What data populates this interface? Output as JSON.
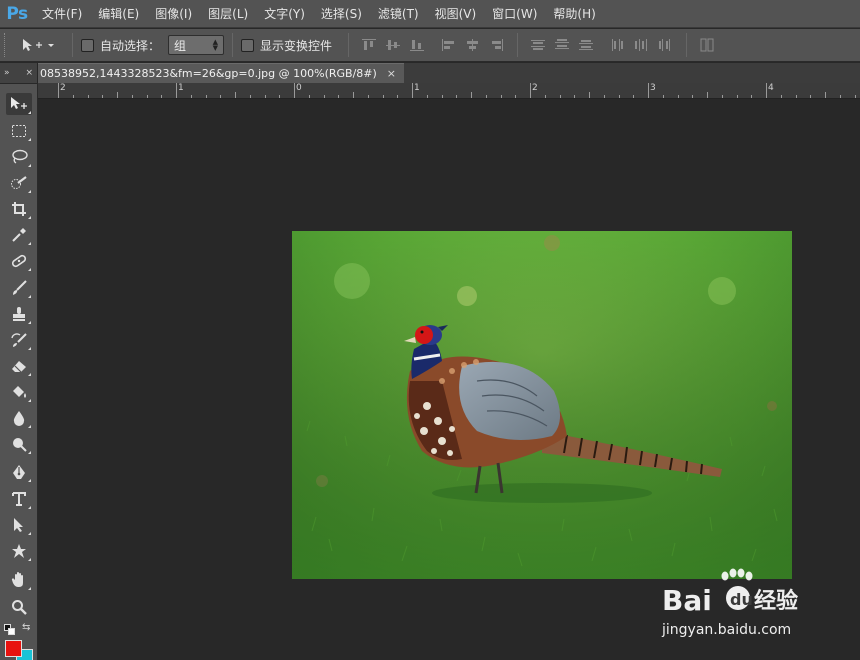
{
  "app": {
    "logo": "Ps"
  },
  "menu": {
    "items": [
      "文件(F)",
      "编辑(E)",
      "图像(I)",
      "图层(L)",
      "文字(Y)",
      "选择(S)",
      "滤镜(T)",
      "视图(V)",
      "窗口(W)",
      "帮助(H)"
    ]
  },
  "options": {
    "auto_select_label": "自动选择：",
    "auto_select_value": "组",
    "show_transform_label": "显示变换控件"
  },
  "document": {
    "tab_title": "08538952,1443328523&fm=26&gp=0.jpg @ 100%(RGB/8#)",
    "close_symbol": "×"
  },
  "panel_collapse": {
    "expand": "»",
    "close": "×"
  },
  "ruler": {
    "labels": [
      "2",
      "1",
      "0",
      "1",
      "2",
      "3",
      "4"
    ]
  },
  "colors": {
    "foreground": "#e8130f",
    "background": "#19c3d6",
    "accent": "#4aa8e8"
  },
  "watermark": {
    "brand_left": "Bai",
    "brand_right": "经验",
    "url": "jingyan.baidu.com"
  },
  "icons": {
    "toolbox": [
      "move-icon",
      "marquee-icon",
      "lasso-icon",
      "quick-select-icon",
      "crop-icon",
      "eyedropper-icon",
      "healing-brush-icon",
      "brush-icon",
      "clone-stamp-icon",
      "history-brush-icon",
      "eraser-icon",
      "paint-bucket-icon",
      "blur-icon",
      "dodge-icon",
      "pen-icon",
      "type-icon",
      "path-select-icon",
      "custom-shape-icon",
      "hand-icon",
      "zoom-icon"
    ]
  }
}
